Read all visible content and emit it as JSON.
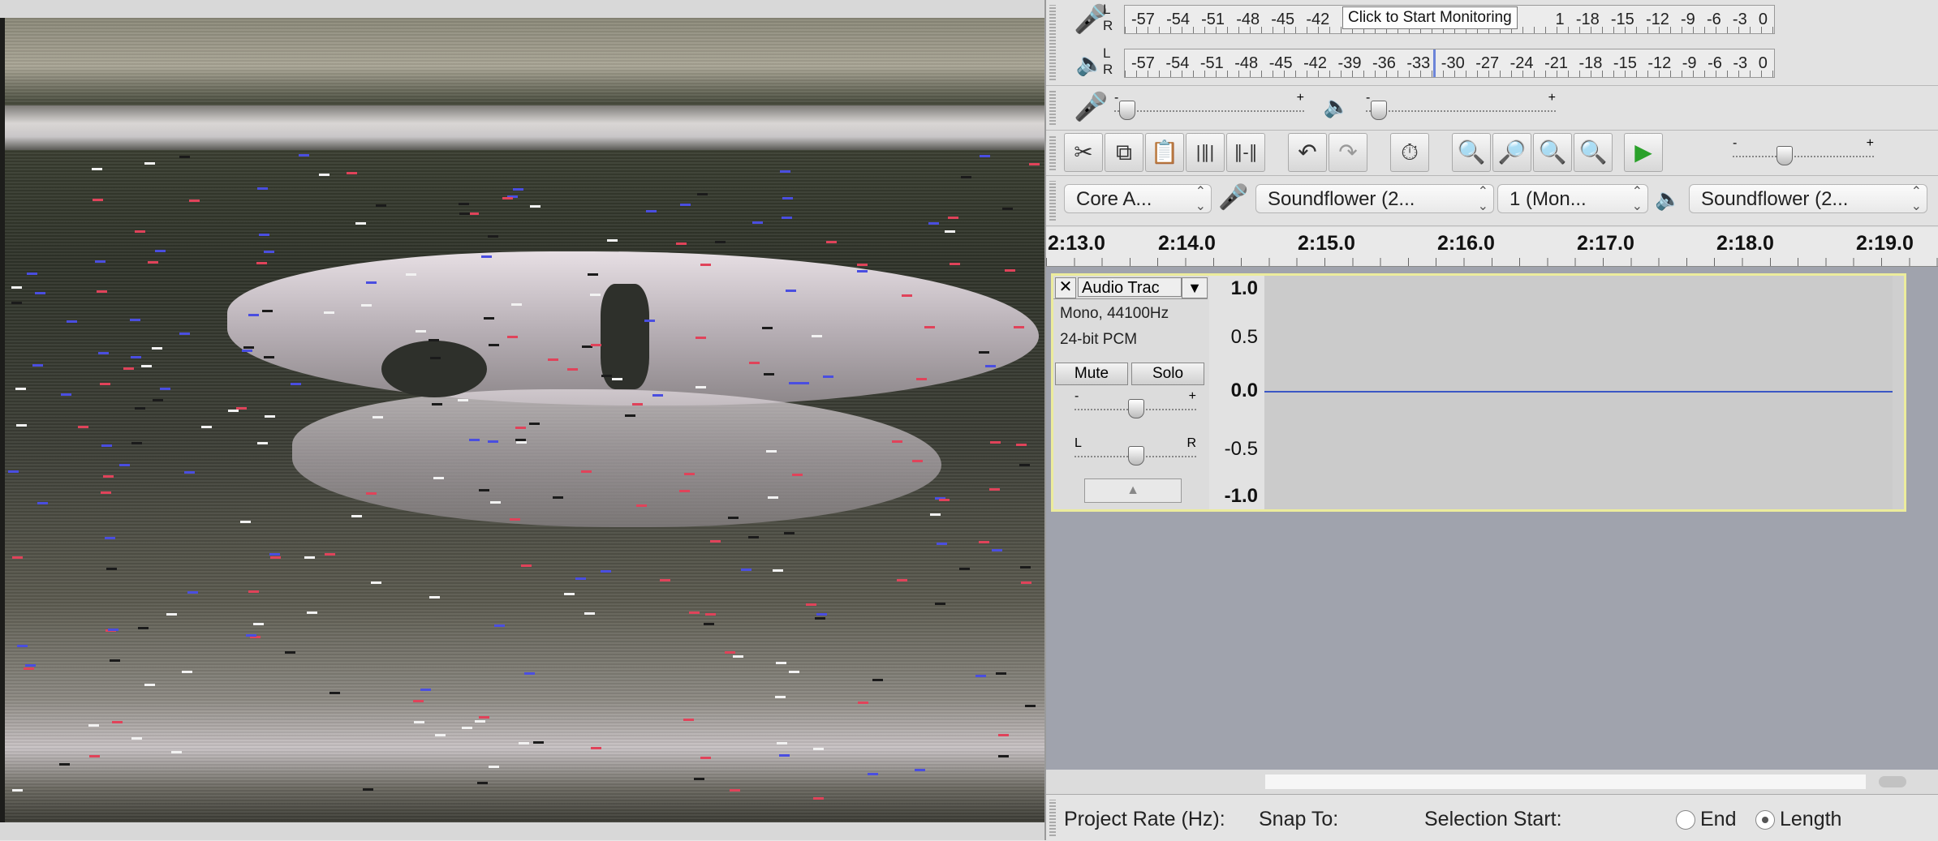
{
  "recording_meter": {
    "scale": [
      "-57",
      "-54",
      "-51",
      "-48",
      "-45",
      "-42"
    ],
    "scale_right": [
      "1",
      "-18",
      "-15",
      "-12",
      "-9",
      "-6",
      "-3",
      "0"
    ],
    "tooltip": "Click to Start Monitoring"
  },
  "playback_meter": {
    "scale": [
      "-57",
      "-54",
      "-51",
      "-48",
      "-45",
      "-42",
      "-39",
      "-36",
      "-33",
      "-30",
      "-27",
      "-24",
      "-21",
      "-18",
      "-15",
      "-12",
      "-9",
      "-6",
      "-3",
      "0"
    ]
  },
  "mixer": {
    "minus": "-",
    "plus": "+"
  },
  "device_toolbar": {
    "host": "Core A...",
    "recording_device": "Soundflower (2...",
    "channels": "1 (Mon...",
    "playback_device": "Soundflower (2..."
  },
  "timeline": {
    "labels": [
      "2:13.0",
      "2:14.0",
      "2:15.0",
      "2:16.0",
      "2:17.0",
      "2:18.0",
      "2:19.0"
    ]
  },
  "track": {
    "name": "Audio Trac",
    "format": "Mono, 44100Hz",
    "bit_depth": "24-bit PCM",
    "mute_label": "Mute",
    "solo_label": "Solo",
    "gain_minus": "-",
    "gain_plus": "+",
    "pan_left": "L",
    "pan_right": "R",
    "vruler": [
      "1.0",
      "0.5",
      "0.0",
      "-0.5",
      "-1.0"
    ],
    "waveform_color": "#3b57c4",
    "selected_border_color": "#ecec9c"
  },
  "status_bar": {
    "project_rate_label": "Project Rate (Hz):",
    "snap_to_label": "Snap To:",
    "selection_start_label": "Selection Start:",
    "end_label": "End",
    "length_label": "Length",
    "length_selected": true
  },
  "icons": {
    "mic": "microphone-icon",
    "speaker": "speaker-icon",
    "play": "play-icon"
  }
}
